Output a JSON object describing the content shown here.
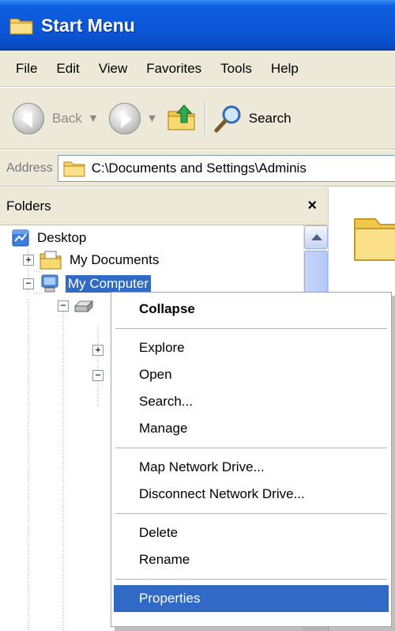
{
  "window": {
    "title": "Start Menu"
  },
  "menubar": {
    "items": [
      "File",
      "Edit",
      "View",
      "Favorites",
      "Tools",
      "Help"
    ]
  },
  "toolbar": {
    "back_label": "Back",
    "search_label": "Search"
  },
  "address": {
    "label": "Address",
    "path": "C:\\Documents and Settings\\Adminis"
  },
  "folders": {
    "header": "Folders",
    "close_symbol": "×",
    "tree": [
      {
        "label": "Desktop",
        "icon": "desktop-icon",
        "expander": "",
        "selected": false
      },
      {
        "label": "My Documents",
        "icon": "my-documents-icon",
        "expander": "+",
        "selected": false
      },
      {
        "label": "My Computer",
        "icon": "my-computer-icon",
        "expander": "−",
        "selected": true
      }
    ]
  },
  "context_menu": {
    "groups": [
      [
        {
          "label": "Collapse",
          "bold": true
        }
      ],
      [
        {
          "label": "Explore"
        },
        {
          "label": "Open"
        },
        {
          "label": "Search..."
        },
        {
          "label": "Manage"
        }
      ],
      [
        {
          "label": "Map Network Drive..."
        },
        {
          "label": "Disconnect Network Drive..."
        }
      ],
      [
        {
          "label": "Delete"
        },
        {
          "label": "Rename"
        }
      ],
      [
        {
          "label": "Properties",
          "highlighted": true
        }
      ]
    ]
  },
  "colors": {
    "title_bar": "#0b56d6",
    "selection": "#316ac5",
    "chrome": "#ece9d8"
  }
}
